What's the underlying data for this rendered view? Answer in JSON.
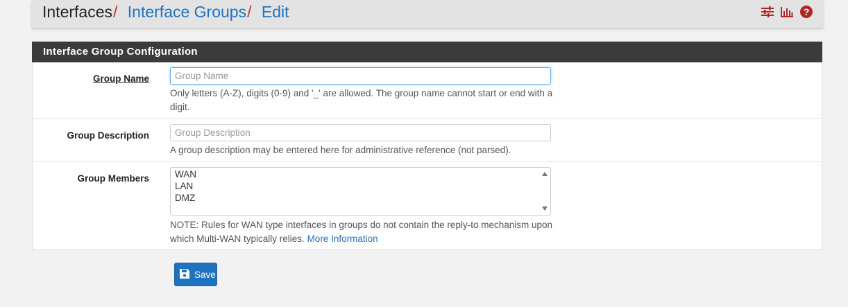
{
  "breadcrumb": {
    "items": [
      {
        "label": "Interfaces"
      },
      {
        "label": "Interface Groups"
      },
      {
        "label": "Edit"
      }
    ],
    "separator": "/"
  },
  "top_icons": [
    "sliders-icon",
    "bar-chart-icon",
    "help-icon"
  ],
  "colors": {
    "accent": "#1e73be",
    "separator": "#c9302c",
    "heading_bg": "#3b3b3b",
    "icon_red": "#b32525"
  },
  "panel": {
    "title": "Interface Group Configuration",
    "fields": {
      "group_name": {
        "label": "Group Name",
        "placeholder": "Group Name",
        "value": "",
        "help": "Only letters (A-Z), digits (0-9) and '_' are allowed. The group name cannot start or end with a digit."
      },
      "group_description": {
        "label": "Group Description",
        "placeholder": "Group Description",
        "value": "",
        "help": "A group description may be entered here for administrative reference (not parsed)."
      },
      "group_members": {
        "label": "Group Members",
        "options": [
          "WAN",
          "LAN",
          "DMZ"
        ],
        "help": "NOTE: Rules for WAN type interfaces in groups do not contain the reply-to mechanism upon which Multi-WAN typically relies.",
        "help_link": "More Information"
      }
    }
  },
  "save_button": {
    "label": "Save",
    "icon": "floppy-disk-icon"
  }
}
